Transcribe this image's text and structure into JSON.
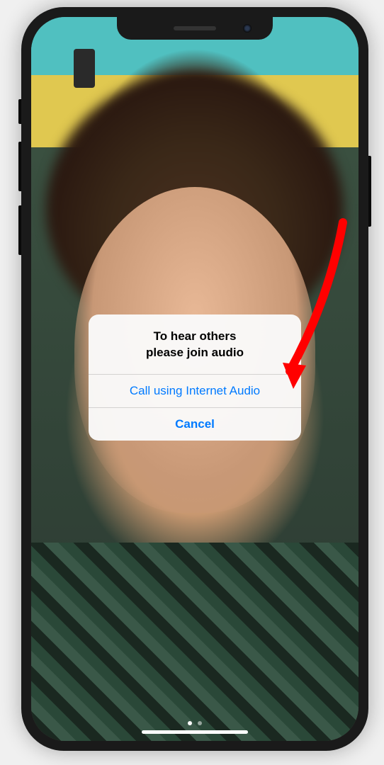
{
  "dialog": {
    "title_line1": "To hear others",
    "title_line2": "please join audio",
    "primary_action": "Call using Internet Audio",
    "cancel_action": "Cancel"
  },
  "annotation": {
    "arrow_color": "#ff0000"
  }
}
